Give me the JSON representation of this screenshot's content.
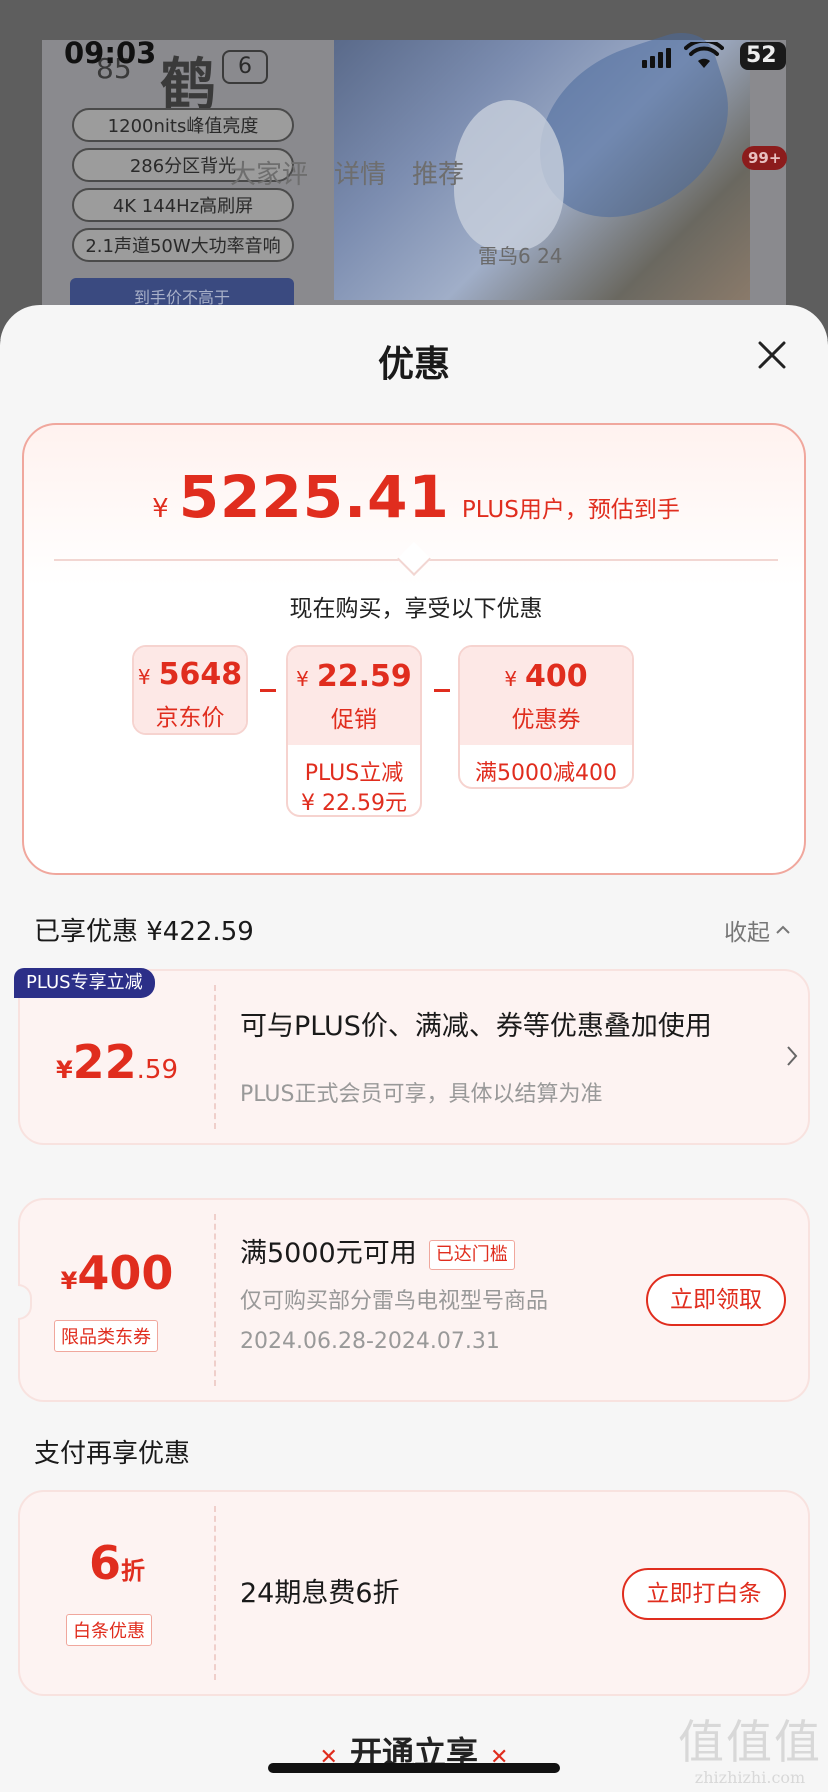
{
  "status": {
    "time": "09:03",
    "battery": "52"
  },
  "background": {
    "logo_num": "85",
    "logo_glyph": "鹤",
    "logo_gen": "6",
    "features": [
      "1200nits峰值亮度",
      "286分区背光",
      "4K 144Hz高刷屏",
      "2.1声道50W大功率音响"
    ],
    "blue_button": "到手价不高于",
    "tabs": [
      "大家评",
      "详情",
      "推荐"
    ],
    "badge": "99+",
    "faint_price": "雷鸟6 24"
  },
  "sheet": {
    "title": "优惠",
    "summary": {
      "currency": "¥",
      "amount": "5225.41",
      "note": "PLUS用户，预估到手",
      "sub": "现在购买，享受以下优惠"
    },
    "breakdown": [
      {
        "value": "5648",
        "label": "京东价",
        "detail": []
      },
      {
        "value": "22.59",
        "label": "促销",
        "detail": [
          "PLUS立减",
          "¥ 22.59元"
        ]
      },
      {
        "value": "400",
        "label": "优惠券",
        "detail": [
          "满5000减400"
        ]
      }
    ],
    "enjoyed": {
      "title": "已享优惠 ¥422.59",
      "collapse": "收起"
    },
    "plus_coupon": {
      "badge": "PLUS专享立减",
      "currency": "¥",
      "int": "22",
      "dec": ".59",
      "main": "可与PLUS价、满减、券等优惠叠加使用",
      "sub": "PLUS正式会员可享，具体以结算为准"
    },
    "store_coupon": {
      "currency": "¥",
      "amount": "400",
      "tag": "限品类东券",
      "main": "满5000元可用",
      "threshold": "已达门槛",
      "sub1": "仅可购买部分雷鸟电视型号商品",
      "sub2": "2024.06.28-2024.07.31",
      "button": "立即领取"
    },
    "pay_title": "支付再享优惠",
    "baitiao": {
      "amount": "6",
      "unit": "折",
      "tag": "白条优惠",
      "main": "24期息费6折",
      "button": "立即打白条"
    },
    "bottom_text": "开通立享",
    "watermark": {
      "big": "值值值",
      "small": "zhizhizhi.com"
    }
  },
  "colors": {
    "accent": "#e02d1e",
    "plus_badge": "#2c2f88"
  }
}
